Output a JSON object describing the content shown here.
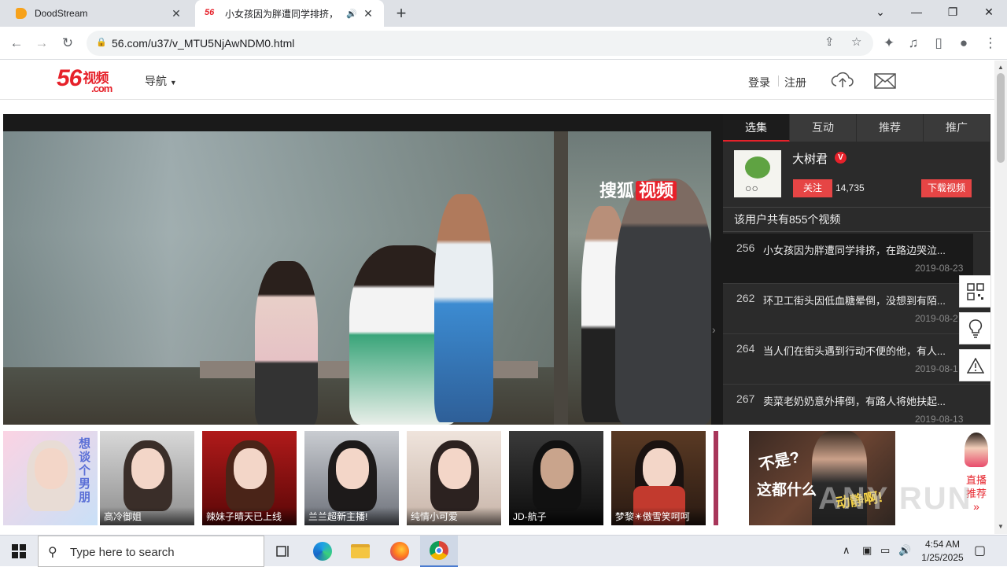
{
  "browser": {
    "tabs": [
      {
        "title": "DoodStream",
        "active": false
      },
      {
        "title": "小女孩因为胖遭同学排挤，",
        "active": true
      }
    ],
    "url": "56.com/u37/v_MTU5NjAwNDM0.html"
  },
  "site": {
    "logo_main": "56",
    "logo_suffix": "视频",
    "logo_domain": ".com",
    "nav_label": "导航",
    "login": "登录",
    "register": "注册"
  },
  "player": {
    "watermark_text": "搜狐",
    "watermark_badge": "视频"
  },
  "sidebar": {
    "tabs": [
      "选集",
      "互动",
      "推荐",
      "推广"
    ],
    "owner_name": "大树君",
    "verified_mark": "V",
    "follow": "关注",
    "fans": "14,735",
    "download": "下载视频",
    "video_count": "该用户共有855个视频",
    "videos": [
      {
        "num": "256",
        "title": "小女孩因为胖遭同学排挤，在路边哭泣...",
        "date": "2019-08-23"
      },
      {
        "num": "262",
        "title": "环卫工街头因低血糖晕倒，没想到有陌...",
        "date": "2019-08-2"
      },
      {
        "num": "264",
        "title": "当人们在街头遇到行动不便的他，有人...",
        "date": "2019-08-1"
      },
      {
        "num": "267",
        "title": "卖菜老奶奶意外摔倒，有路人将她扶起...",
        "date": "2019-08-13"
      }
    ]
  },
  "thumbs": [
    {
      "caption": "",
      "text": "想谈个男朋"
    },
    {
      "caption": "高冷御姐",
      "text": ""
    },
    {
      "caption": "辣妹子晴天已上线",
      "text": ""
    },
    {
      "caption": "兰兰超新主播!",
      "text": ""
    },
    {
      "caption": "纯情小可爱",
      "text": ""
    },
    {
      "caption": "JD-航子",
      "text": ""
    },
    {
      "caption": "梦黎☀傲雪笑呵呵",
      "text": ""
    }
  ],
  "promo": {
    "line1": "不是?",
    "line2": "这都什么",
    "line3": "动静啊!"
  },
  "live": {
    "line1": "直播",
    "line2": "推荐",
    "arrow": "»"
  },
  "watermark_overlay": "ANY RUN",
  "taskbar": {
    "search_placeholder": "Type here to search",
    "time": "4:54 AM",
    "date": "1/25/2025"
  },
  "colors": {
    "brand_red": "#e6212a",
    "sidebar_bg": "#2b2b2b",
    "taskbar_bg": "#e7eaf0"
  }
}
